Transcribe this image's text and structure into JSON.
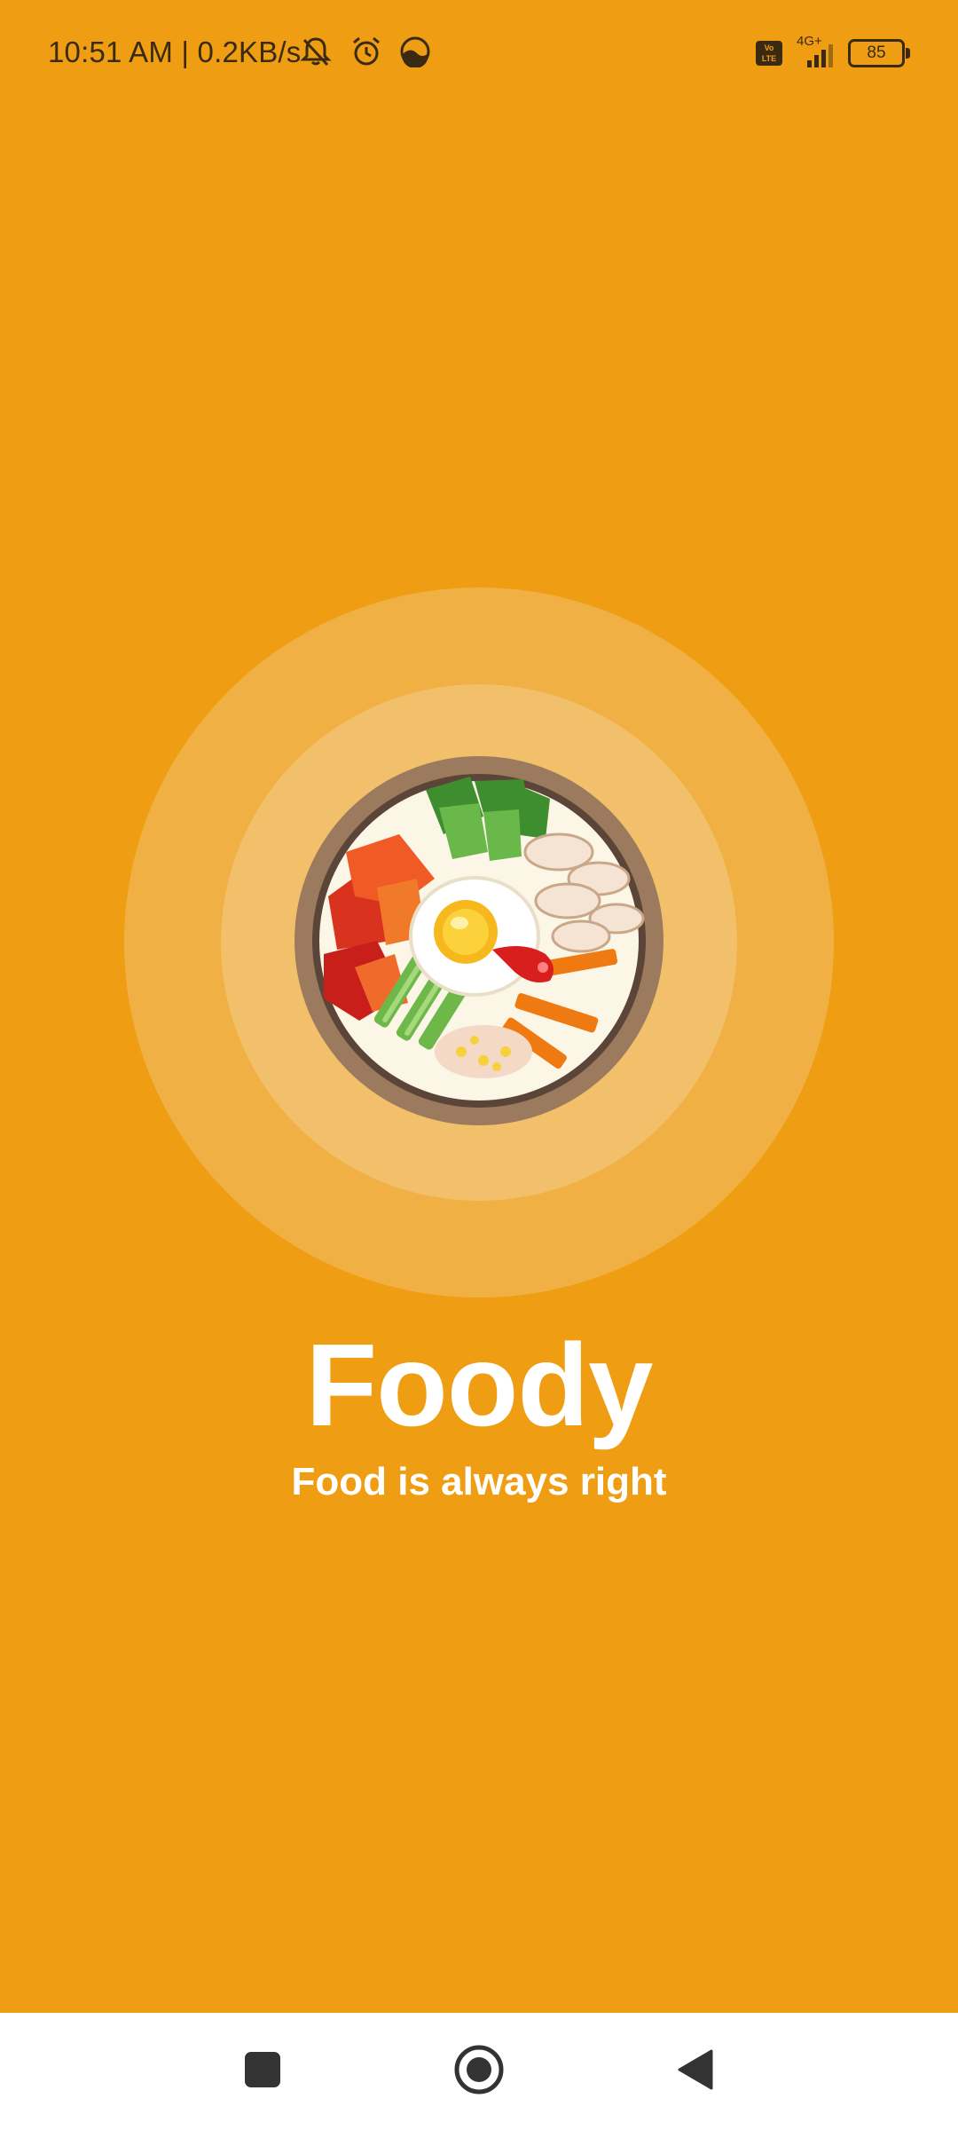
{
  "status_bar": {
    "time_and_speed": "10:51 AM | 0.2KB/s",
    "network": "4G+",
    "volte_top": "Vo",
    "volte_bottom": "LTE",
    "battery": "85"
  },
  "splash": {
    "title": "Foody",
    "tagline": "Food is always right"
  },
  "colors": {
    "background": "#EF9E13",
    "ring_outer": "#F0B043",
    "ring_inner": "#F2C06A",
    "text": "#FFFFFF"
  },
  "icons": {
    "mute": "bell-off-icon",
    "alarm": "alarm-clock-icon",
    "app_status": "half-moon-icon",
    "signal": "signal-bars-icon",
    "battery": "battery-icon",
    "logo": "bibimbap-bowl-icon",
    "recents": "square-icon",
    "home": "circle-icon",
    "back": "triangle-back-icon"
  }
}
